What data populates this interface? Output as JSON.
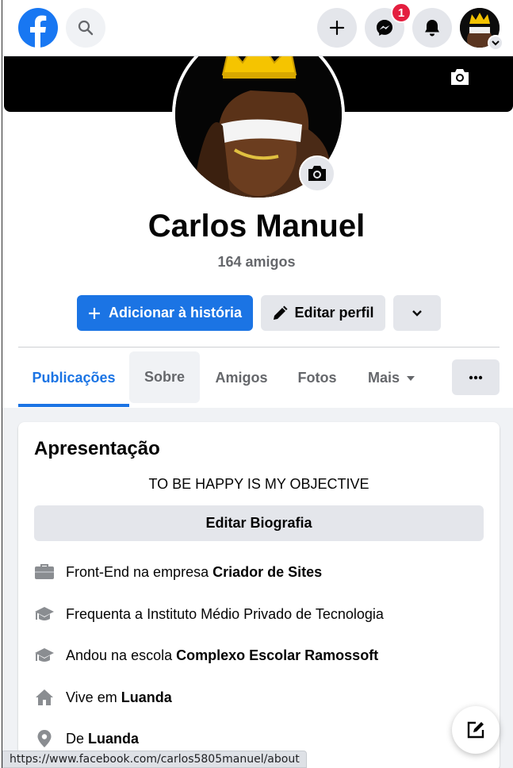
{
  "nav": {
    "messenger_badge": "1"
  },
  "profile": {
    "name": "Carlos Manuel",
    "friends": "164 amigos"
  },
  "actions": {
    "add_story": "Adicionar à história",
    "edit_profile": "Editar perfil"
  },
  "tabs": {
    "posts": "Publicações",
    "about": "Sobre",
    "friends": "Amigos",
    "photos": "Fotos",
    "more": "Mais"
  },
  "intro": {
    "title": "Apresentação",
    "bio": "TO BE HAPPY IS MY OBJECTIVE",
    "edit_bio": "Editar Biografia",
    "items": [
      {
        "icon": "briefcase-icon",
        "text": "Front-End na empresa",
        "bold": "Criador de Sites"
      },
      {
        "icon": "graduation-cap-icon",
        "text": "Frequenta a Instituto Médio Privado de Tecnologia",
        "bold": ""
      },
      {
        "icon": "graduation-cap-icon",
        "text": "Andou na escola",
        "bold": "Complexo Escolar Ramossoft"
      },
      {
        "icon": "home-icon",
        "text": "Vive em",
        "bold": "Luanda"
      },
      {
        "icon": "location-pin-icon",
        "text": "De",
        "bold": "Luanda"
      }
    ]
  },
  "status_url": "https://www.facebook.com/carlos5805manuel/about",
  "colors": {
    "primary": "#1b74e4",
    "badge": "#e41e3f",
    "secondary_bg": "#e4e6eb",
    "page_bg": "#f0f2f5"
  }
}
